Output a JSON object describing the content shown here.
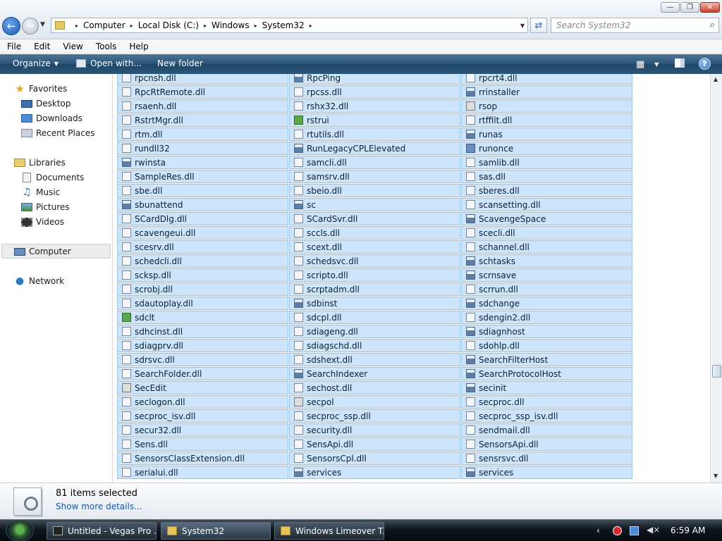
{
  "window": {
    "buttons": {
      "minimize": "—",
      "maximize": "❐",
      "close": "✕"
    }
  },
  "address": {
    "crumbs": [
      "Computer",
      "Local Disk (C:)",
      "Windows",
      "System32"
    ],
    "separator": "▸"
  },
  "search": {
    "placeholder": "Search System32"
  },
  "menu": [
    "File",
    "Edit",
    "View",
    "Tools",
    "Help"
  ],
  "toolbar": {
    "organize": "Organize",
    "open_with": "Open with...",
    "new_folder": "New folder",
    "help": "?"
  },
  "nav": {
    "favorites": "Favorites",
    "desktop": "Desktop",
    "downloads": "Downloads",
    "recent_places": "Recent Places",
    "libraries": "Libraries",
    "documents": "Documents",
    "music": "Music",
    "pictures": "Pictures",
    "videos": "Videos",
    "computer": "Computer",
    "network": "Network"
  },
  "files": {
    "col1": [
      {
        "name": "rpcnsh.dll",
        "icon": "dll"
      },
      {
        "name": "RpcRtRemote.dll",
        "icon": "dll"
      },
      {
        "name": "rsaenh.dll",
        "icon": "dll"
      },
      {
        "name": "RstrtMgr.dll",
        "icon": "dll"
      },
      {
        "name": "rtm.dll",
        "icon": "dll"
      },
      {
        "name": "rundll32",
        "icon": "file"
      },
      {
        "name": "rwinsta",
        "icon": "exe"
      },
      {
        "name": "SampleRes.dll",
        "icon": "dll"
      },
      {
        "name": "sbe.dll",
        "icon": "dll"
      },
      {
        "name": "sbunattend",
        "icon": "exe"
      },
      {
        "name": "SCardDlg.dll",
        "icon": "dll"
      },
      {
        "name": "scavengeui.dll",
        "icon": "dll"
      },
      {
        "name": "scesrv.dll",
        "icon": "dll"
      },
      {
        "name": "schedcli.dll",
        "icon": "dll"
      },
      {
        "name": "scksp.dll",
        "icon": "dll"
      },
      {
        "name": "scrobj.dll",
        "icon": "dll"
      },
      {
        "name": "sdautoplay.dll",
        "icon": "dll"
      },
      {
        "name": "sdclt",
        "icon": "green"
      },
      {
        "name": "sdhcinst.dll",
        "icon": "dll"
      },
      {
        "name": "sdiagprv.dll",
        "icon": "dll"
      },
      {
        "name": "sdrsvc.dll",
        "icon": "dll"
      },
      {
        "name": "SearchFolder.dll",
        "icon": "dll"
      },
      {
        "name": "SecEdit",
        "icon": "ctl"
      },
      {
        "name": "seclogon.dll",
        "icon": "dll"
      },
      {
        "name": "secproc_isv.dll",
        "icon": "dll"
      },
      {
        "name": "secur32.dll",
        "icon": "dll"
      },
      {
        "name": "Sens.dll",
        "icon": "dll"
      },
      {
        "name": "SensorsClassExtension.dll",
        "icon": "dll"
      },
      {
        "name": "serialui.dll",
        "icon": "dll"
      }
    ],
    "col2": [
      {
        "name": "RpcPing",
        "icon": "exe"
      },
      {
        "name": "rpcss.dll",
        "icon": "dll"
      },
      {
        "name": "rshx32.dll",
        "icon": "dll"
      },
      {
        "name": "rstrui",
        "icon": "green"
      },
      {
        "name": "rtutils.dll",
        "icon": "dll"
      },
      {
        "name": "RunLegacyCPLElevated",
        "icon": "exe"
      },
      {
        "name": "samcli.dll",
        "icon": "dll"
      },
      {
        "name": "samsrv.dll",
        "icon": "dll"
      },
      {
        "name": "sbeio.dll",
        "icon": "dll"
      },
      {
        "name": "sc",
        "icon": "exe"
      },
      {
        "name": "SCardSvr.dll",
        "icon": "dll"
      },
      {
        "name": "sccls.dll",
        "icon": "dll"
      },
      {
        "name": "scext.dll",
        "icon": "dll"
      },
      {
        "name": "schedsvc.dll",
        "icon": "dll"
      },
      {
        "name": "scripto.dll",
        "icon": "dll"
      },
      {
        "name": "scrptadm.dll",
        "icon": "dll"
      },
      {
        "name": "sdbinst",
        "icon": "exe"
      },
      {
        "name": "sdcpl.dll",
        "icon": "dll"
      },
      {
        "name": "sdiageng.dll",
        "icon": "dll"
      },
      {
        "name": "sdiagschd.dll",
        "icon": "dll"
      },
      {
        "name": "sdshext.dll",
        "icon": "dll"
      },
      {
        "name": "SearchIndexer",
        "icon": "exe"
      },
      {
        "name": "sechost.dll",
        "icon": "dll"
      },
      {
        "name": "secpol",
        "icon": "ctl"
      },
      {
        "name": "secproc_ssp.dll",
        "icon": "dll"
      },
      {
        "name": "security.dll",
        "icon": "dll"
      },
      {
        "name": "SensApi.dll",
        "icon": "dll"
      },
      {
        "name": "SensorsCpl.dll",
        "icon": "dll"
      },
      {
        "name": "services",
        "icon": "exe"
      }
    ],
    "col3": [
      {
        "name": "rpcrt4.dll",
        "icon": "dll"
      },
      {
        "name": "rrinstaller",
        "icon": "exe"
      },
      {
        "name": "rsop",
        "icon": "ctl"
      },
      {
        "name": "rtffilt.dll",
        "icon": "dll"
      },
      {
        "name": "runas",
        "icon": "exe"
      },
      {
        "name": "runonce",
        "icon": "shield"
      },
      {
        "name": "samlib.dll",
        "icon": "dll"
      },
      {
        "name": "sas.dll",
        "icon": "dll"
      },
      {
        "name": "sberes.dll",
        "icon": "dll"
      },
      {
        "name": "scansetting.dll",
        "icon": "dll"
      },
      {
        "name": "ScavengeSpace",
        "icon": "exe"
      },
      {
        "name": "scecli.dll",
        "icon": "dll"
      },
      {
        "name": "schannel.dll",
        "icon": "dll"
      },
      {
        "name": "schtasks",
        "icon": "exe"
      },
      {
        "name": "scrnsave",
        "icon": "exe"
      },
      {
        "name": "scrrun.dll",
        "icon": "dll"
      },
      {
        "name": "sdchange",
        "icon": "exe"
      },
      {
        "name": "sdengin2.dll",
        "icon": "dll"
      },
      {
        "name": "sdiagnhost",
        "icon": "exe"
      },
      {
        "name": "sdohlp.dll",
        "icon": "dll"
      },
      {
        "name": "SearchFilterHost",
        "icon": "exe"
      },
      {
        "name": "SearchProtocolHost",
        "icon": "exe"
      },
      {
        "name": "secinit",
        "icon": "exe"
      },
      {
        "name": "secproc.dll",
        "icon": "dll"
      },
      {
        "name": "secproc_ssp_isv.dll",
        "icon": "dll"
      },
      {
        "name": "sendmail.dll",
        "icon": "dll"
      },
      {
        "name": "SensorsApi.dll",
        "icon": "dll"
      },
      {
        "name": "sensrsvc.dll",
        "icon": "dll"
      },
      {
        "name": "services",
        "icon": "gear"
      }
    ]
  },
  "details": {
    "selection": "81 items selected",
    "more_details": "Show more details..."
  },
  "taskbar": {
    "tasks": [
      "Untitled - Vegas Pro ...",
      "System32",
      "Windows Limeover T..."
    ],
    "clock": "6:59 AM",
    "tray_expand": "‹"
  }
}
